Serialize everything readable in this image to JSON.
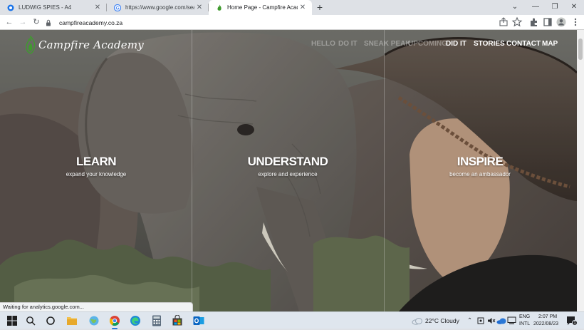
{
  "browser": {
    "tabs": [
      {
        "title": "LUDWIG SPIES - A4",
        "close": "✕"
      },
      {
        "title": "https://www.google.com/search?q",
        "close": "✕"
      },
      {
        "title": "Home Page - Campfire Academy",
        "close": "✕"
      }
    ],
    "new_tab": "+",
    "window_controls": {
      "tab_search": "⌄",
      "minimize": "—",
      "restore": "❐",
      "close": "✕"
    },
    "toolbar": {
      "back": "←",
      "forward": "→",
      "reload": "↻",
      "url": "campfireacademy.co.za"
    },
    "status_text": "Waiting for analytics.google.com..."
  },
  "site": {
    "logo_text": "Campfire Academy",
    "nav": [
      {
        "label": "HELLO"
      },
      {
        "label": "DO IT"
      },
      {
        "label": "SNEAK PEAK"
      },
      {
        "label": "UPCOMING"
      },
      {
        "label": "DID IT"
      },
      {
        "label": "STORIES"
      },
      {
        "label": "CONTACT"
      },
      {
        "label": "MAP"
      }
    ],
    "columns": [
      {
        "title": "LEARN",
        "subtitle": "expand your knowledge"
      },
      {
        "title": "UNDERSTAND",
        "subtitle": "explore and experience"
      },
      {
        "title": "INSPIRE",
        "subtitle": "become an ambassador"
      }
    ]
  },
  "taskbar": {
    "weather": "22°C  Cloudy",
    "language_top": "ENG",
    "language_bottom": "INTL",
    "time": "2:07 PM",
    "date": "2022/08/23",
    "notification_count": "1"
  },
  "colors": {
    "brand_green": "#3f9b2e",
    "taskbar_accent": "#2b78d6"
  }
}
